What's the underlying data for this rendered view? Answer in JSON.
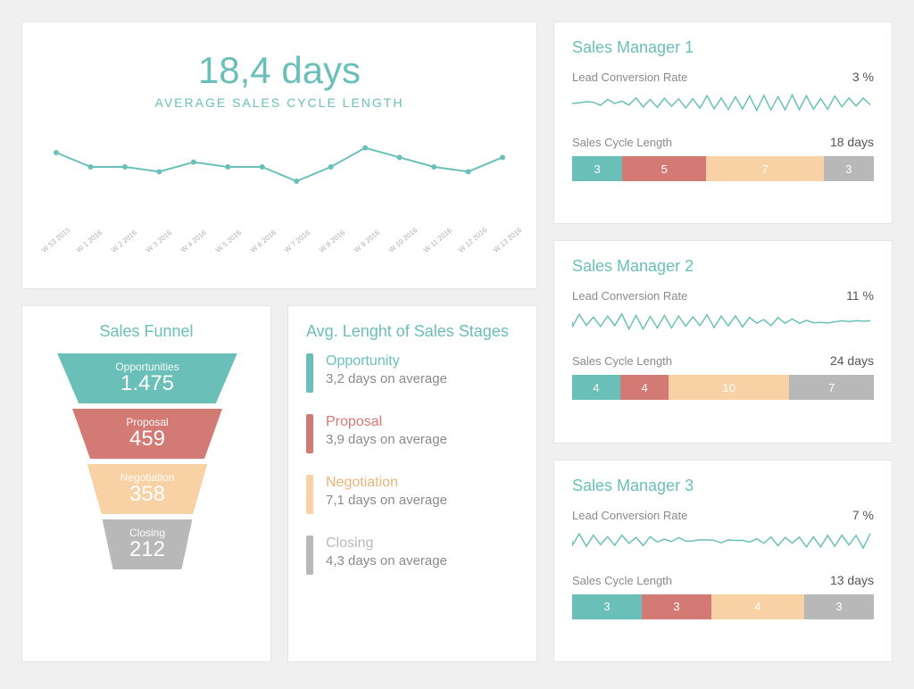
{
  "cycle": {
    "value": "18,4 days",
    "label": "AVERAGE SALES CYCLE LENGTH"
  },
  "funnel": {
    "title": "Sales Funnel",
    "segments": [
      {
        "label": "Opportunities",
        "value": "1.475"
      },
      {
        "label": "Proposal",
        "value": "459"
      },
      {
        "label": "Negotiation",
        "value": "358"
      },
      {
        "label": "Closing",
        "value": "212"
      }
    ]
  },
  "stages": {
    "title": "Avg. Lenght of Sales Stages",
    "items": [
      {
        "name": "Opportunity",
        "sub": "3,2 days on average"
      },
      {
        "name": "Proposal",
        "sub": "3,9 days on average"
      },
      {
        "name": "Negotiation",
        "sub": "7,1 days on average"
      },
      {
        "name": "Closing",
        "sub": "4,3 days on average"
      }
    ]
  },
  "managers": [
    {
      "title": "Sales Manager 1",
      "conv_label": "Lead Conversion Rate",
      "conv_value": "3 %",
      "len_label": "Sales Cycle Length",
      "len_value": "18 days",
      "bars": [
        "3",
        "5",
        "7",
        "3"
      ]
    },
    {
      "title": "Sales Manager 2",
      "conv_label": "Lead Conversion Rate",
      "conv_value": "11 %",
      "len_label": "Sales Cycle Length",
      "len_value": "24 days",
      "bars": [
        "4",
        "4",
        "10",
        "7"
      ]
    },
    {
      "title": "Sales Manager 3",
      "conv_label": "Lead Conversion Rate",
      "conv_value": "7 %",
      "len_label": "Sales Cycle Length",
      "len_value": "13 days",
      "bars": [
        "3",
        "3",
        "4",
        "3"
      ]
    }
  ],
  "chart_data": {
    "cycle_line": {
      "type": "line",
      "title": "Average Sales Cycle Length",
      "ylabel": "days",
      "categories": [
        "W 53 2015",
        "W 1 2016",
        "W 2 2016",
        "W 3 2016",
        "W 4 2016",
        "W 5 2016",
        "W 6 2016",
        "W 7 2016",
        "W 8 2016",
        "W 9 2016",
        "W 10 2016",
        "W 11 2016",
        "W 12 2016",
        "W 13 2016"
      ],
      "values": [
        21,
        18,
        18,
        17,
        19,
        18,
        18,
        15,
        18,
        22,
        20,
        18,
        17,
        20
      ],
      "ylim": [
        12,
        24
      ]
    },
    "funnel_chart": {
      "type": "bar",
      "title": "Sales Funnel",
      "categories": [
        "Opportunities",
        "Proposal",
        "Negotiation",
        "Closing"
      ],
      "values": [
        1475,
        459,
        358,
        212
      ]
    },
    "stage_lengths": {
      "type": "bar",
      "title": "Avg. Length of Sales Stages (days)",
      "categories": [
        "Opportunity",
        "Proposal",
        "Negotiation",
        "Closing"
      ],
      "values": [
        3.2,
        3.9,
        7.1,
        4.3
      ]
    },
    "manager_cycle_breakdown": {
      "type": "bar",
      "title": "Sales Cycle Length by Manager (days per stage)",
      "categories": [
        "Opportunity",
        "Proposal",
        "Negotiation",
        "Closing"
      ],
      "series": [
        {
          "name": "Sales Manager 1",
          "values": [
            3,
            5,
            7,
            3
          ]
        },
        {
          "name": "Sales Manager 2",
          "values": [
            4,
            4,
            10,
            7
          ]
        },
        {
          "name": "Sales Manager 3",
          "values": [
            3,
            3,
            4,
            3
          ]
        }
      ]
    },
    "manager_conversion": {
      "type": "bar",
      "title": "Lead Conversion Rate by Manager (%)",
      "categories": [
        "Sales Manager 1",
        "Sales Manager 2",
        "Sales Manager 3"
      ],
      "values": [
        3,
        11,
        7
      ]
    }
  }
}
